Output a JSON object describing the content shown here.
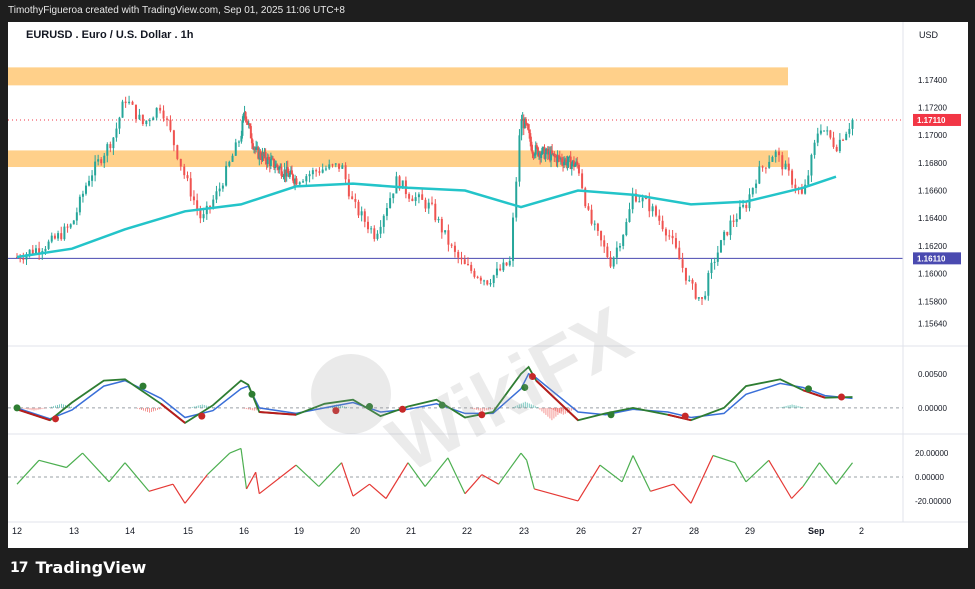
{
  "header": {
    "attribution": "TimothyFigueroa created with TradingView.com, Sep 01, 2025 11:06 UTC+8"
  },
  "footer": {
    "brand": "TradingView",
    "logo": "17"
  },
  "watermark": "WikiFX",
  "colors": {
    "bull": "#26a69a",
    "bear": "#ef5350",
    "ma": "#23c4c9",
    "zone": "#ffd08a",
    "macd_fast": "#2e7d32",
    "macd_slow": "#3a6fd8",
    "cross": "#2e7d32",
    "osc_up": "#4caf50",
    "osc_down": "#e53935",
    "price_badge": "#f23645",
    "level_badge": "#4a4ab0"
  },
  "chart_data": [
    {
      "type": "candlestick",
      "title": "EURUSD . Euro / U.S. Dollar . 1h",
      "currency": "USD",
      "ylim": [
        1.1552,
        1.1763
      ],
      "y_ticks": [
        "1.17400",
        "1.17200",
        "1.17000",
        "1.16800",
        "1.16600",
        "1.16400",
        "1.16200",
        "1.16000",
        "1.15800",
        "1.15640"
      ],
      "x_ticks": [
        "12",
        "13",
        "14",
        "15",
        "16",
        "19",
        "20",
        "21",
        "22",
        "23",
        "26",
        "27",
        "28",
        "29",
        "Sep",
        "2"
      ],
      "current_price": "1.17110",
      "horizontal_level": "1.16110",
      "zones": [
        [
          1.1736,
          1.1749
        ],
        [
          1.1677,
          1.1689
        ]
      ],
      "close_path": [
        [
          12,
          1.1612
        ],
        [
          12.6,
          1.1622
        ],
        [
          13,
          1.1635
        ],
        [
          13.3,
          1.1668
        ],
        [
          13.8,
          1.17
        ],
        [
          14,
          1.1727
        ],
        [
          14.3,
          1.1708
        ],
        [
          14.6,
          1.1722
        ],
        [
          15,
          1.167
        ],
        [
          15.3,
          1.1638
        ],
        [
          15.6,
          1.166
        ],
        [
          16,
          1.17
        ],
        [
          16.2,
          1.1718
        ],
        [
          16.5,
          1.1702
        ],
        [
          16.8,
          1.1688
        ],
        [
          19,
          1.1668
        ],
        [
          19.4,
          1.1675
        ],
        [
          19.8,
          1.1678
        ],
        [
          20,
          1.165
        ],
        [
          20.4,
          1.1628
        ],
        [
          20.8,
          1.1668
        ],
        [
          21,
          1.1658
        ],
        [
          21.4,
          1.1648
        ],
        [
          21.8,
          1.1615
        ],
        [
          22,
          1.1605
        ],
        [
          22.4,
          1.1595
        ],
        [
          22.8,
          1.1608
        ],
        [
          23,
          1.1712
        ],
        [
          23.3,
          1.1705
        ],
        [
          23.6,
          1.169
        ],
        [
          26,
          1.1678
        ],
        [
          26.2,
          1.164
        ],
        [
          26.6,
          1.1608
        ],
        [
          26.9,
          1.1638
        ],
        [
          27,
          1.1658
        ],
        [
          27.3,
          1.1648
        ],
        [
          27.6,
          1.163
        ],
        [
          28,
          1.159
        ],
        [
          28.2,
          1.158
        ],
        [
          28.4,
          1.1608
        ],
        [
          28.7,
          1.1635
        ],
        [
          29,
          1.165
        ],
        [
          29.2,
          1.1672
        ],
        [
          29.5,
          1.1688
        ],
        [
          29.8,
          1.1668
        ],
        [
          30,
          1.1655
        ],
        [
          30.3,
          1.1708
        ],
        [
          30.6,
          1.1692
        ],
        [
          30.9,
          1.1711
        ]
      ],
      "ma_path": [
        [
          12,
          1.1612
        ],
        [
          13,
          1.1618
        ],
        [
          14,
          1.1632
        ],
        [
          15,
          1.1645
        ],
        [
          16,
          1.165
        ],
        [
          19,
          1.1663
        ],
        [
          20,
          1.1665
        ],
        [
          21,
          1.1662
        ],
        [
          22,
          1.166
        ],
        [
          23,
          1.1648
        ],
        [
          26,
          1.166
        ],
        [
          27,
          1.1657
        ],
        [
          28,
          1.165
        ],
        [
          29,
          1.1652
        ],
        [
          30,
          1.1662
        ],
        [
          30.6,
          1.167
        ]
      ]
    },
    {
      "type": "line",
      "name": "macd",
      "ylim": [
        -0.0028,
        0.0082
      ],
      "y_ticks": [
        "0.00500",
        "0.00000"
      ],
      "series": [
        {
          "values": [
            [
              12,
              -0.0002
            ],
            [
              12.6,
              -0.0018
            ],
            [
              13,
              0.0008
            ],
            [
              13.6,
              0.004
            ],
            [
              14,
              0.0042
            ],
            [
              14.6,
              0.0006
            ],
            [
              15,
              -0.0022
            ],
            [
              15.5,
              0.0004
            ],
            [
              16,
              0.004
            ],
            [
              16.4,
              0.0034
            ],
            [
              17,
              -0.0006
            ],
            [
              19,
              -0.001
            ],
            [
              19.5,
              0.0006
            ],
            [
              20,
              0.0012
            ],
            [
              20.5,
              -0.0012
            ],
            [
              21,
              0.0002
            ],
            [
              21.5,
              0.0012
            ],
            [
              22,
              -0.0014
            ],
            [
              22.5,
              -0.0006
            ],
            [
              23,
              0.005
            ],
            [
              23.4,
              0.006
            ],
            [
              23.8,
              0.004
            ],
            [
              26,
              -0.0018
            ],
            [
              26.5,
              -0.0008
            ],
            [
              27,
              0.0
            ],
            [
              27.6,
              -0.001
            ],
            [
              28,
              -0.0018
            ],
            [
              28.6,
              0.0
            ],
            [
              29,
              0.0032
            ],
            [
              29.6,
              0.0042
            ],
            [
              30,
              0.0026
            ],
            [
              30.4,
              0.0015
            ],
            [
              30.9,
              0.0016
            ]
          ]
        },
        {
          "values": [
            [
              12,
              0.0
            ],
            [
              12.6,
              -0.0016
            ],
            [
              13,
              -0.0003
            ],
            [
              13.6,
              0.0032
            ],
            [
              14,
              0.004
            ],
            [
              14.6,
              0.0014
            ],
            [
              15,
              -0.0014
            ],
            [
              15.5,
              -0.0004
            ],
            [
              16,
              0.0028
            ],
            [
              16.4,
              0.0032
            ],
            [
              17,
              0.0
            ],
            [
              19,
              -0.0008
            ],
            [
              19.5,
              0.0
            ],
            [
              20,
              0.0008
            ],
            [
              20.5,
              -0.0006
            ],
            [
              21,
              -0.0002
            ],
            [
              21.5,
              0.0006
            ],
            [
              22,
              -0.0008
            ],
            [
              22.5,
              -0.0008
            ],
            [
              23,
              0.0028
            ],
            [
              23.4,
              0.005
            ],
            [
              23.8,
              0.0044
            ],
            [
              26,
              -0.0006
            ],
            [
              26.5,
              -0.001
            ],
            [
              27,
              -0.0002
            ],
            [
              27.6,
              -0.0006
            ],
            [
              28,
              -0.0014
            ],
            [
              28.6,
              -0.0008
            ],
            [
              29,
              0.002
            ],
            [
              29.6,
              0.0036
            ],
            [
              30,
              0.003
            ],
            [
              30.4,
              0.0018
            ],
            [
              30.9,
              0.0014
            ]
          ]
        }
      ],
      "histogram": [
        [
          12.3,
          -0.0004
        ],
        [
          12.8,
          0.0006
        ],
        [
          14.4,
          -0.0007
        ],
        [
          15.3,
          0.0005
        ],
        [
          16.7,
          -0.0004
        ],
        [
          19.7,
          0.0005
        ],
        [
          22.3,
          -0.0005
        ],
        [
          23.2,
          0.0009
        ],
        [
          24.6,
          -0.0018
        ],
        [
          25.2,
          -0.001
        ],
        [
          29.8,
          0.0005
        ]
      ],
      "cross_markers": [
        [
          12,
          0.0
        ],
        [
          12.7,
          -0.0016
        ],
        [
          14.3,
          0.0032
        ],
        [
          15.3,
          -0.0012
        ],
        [
          16.6,
          0.002
        ],
        [
          19.7,
          -0.0004
        ],
        [
          20.3,
          0.0002
        ],
        [
          20.9,
          -0.0002
        ],
        [
          21.6,
          0.0004
        ],
        [
          22.3,
          -0.001
        ],
        [
          23.2,
          0.003
        ],
        [
          23.6,
          0.0046
        ],
        [
          26.6,
          -0.001
        ],
        [
          27.9,
          -0.0012
        ],
        [
          30.1,
          0.0028
        ],
        [
          30.7,
          0.0016
        ]
      ]
    },
    {
      "type": "line",
      "name": "oscillator",
      "ylim": [
        -31,
        31
      ],
      "y_ticks": [
        "20.00000",
        "0.00000",
        "-20.00000"
      ],
      "values": [
        [
          12,
          -6
        ],
        [
          12.4,
          14
        ],
        [
          12.9,
          8
        ],
        [
          13.2,
          20
        ],
        [
          13.7,
          -4
        ],
        [
          14,
          12
        ],
        [
          14.4,
          -12
        ],
        [
          14.8,
          -6
        ],
        [
          15,
          -22
        ],
        [
          15.4,
          2
        ],
        [
          15.8,
          20
        ],
        [
          16,
          24
        ],
        [
          16.3,
          -10
        ],
        [
          16.8,
          4
        ],
        [
          17,
          -14
        ],
        [
          19,
          10
        ],
        [
          19.4,
          -8
        ],
        [
          19.8,
          12
        ],
        [
          20,
          -16
        ],
        [
          20.3,
          -6
        ],
        [
          20.6,
          -18
        ],
        [
          21,
          12
        ],
        [
          21.3,
          -8
        ],
        [
          21.7,
          16
        ],
        [
          22,
          -14
        ],
        [
          22.3,
          2
        ],
        [
          22.6,
          -6
        ],
        [
          23,
          20
        ],
        [
          23.3,
          14
        ],
        [
          23.7,
          -10
        ],
        [
          26,
          -20
        ],
        [
          26.4,
          10
        ],
        [
          26.8,
          -4
        ],
        [
          27,
          18
        ],
        [
          27.3,
          -12
        ],
        [
          27.7,
          -6
        ],
        [
          28,
          -22
        ],
        [
          28.4,
          18
        ],
        [
          28.8,
          12
        ],
        [
          29,
          -4
        ],
        [
          29.4,
          14
        ],
        [
          29.8,
          -18
        ],
        [
          30,
          -8
        ],
        [
          30.3,
          12
        ],
        [
          30.6,
          -6
        ],
        [
          30.9,
          12
        ]
      ]
    }
  ]
}
